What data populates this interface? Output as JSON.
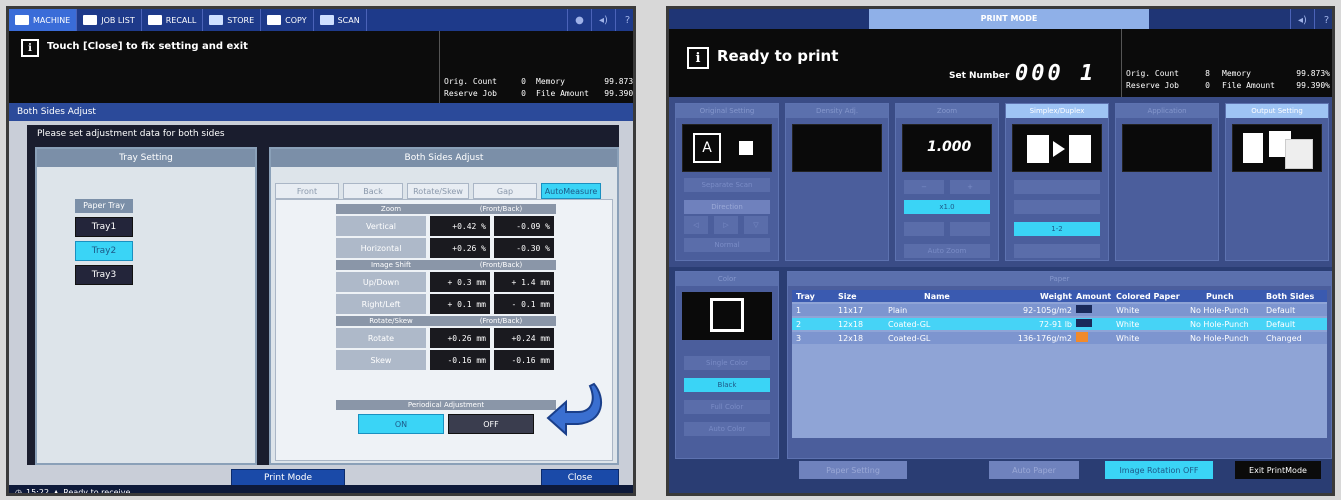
{
  "left": {
    "tabs": [
      "MACHINE",
      "JOB LIST",
      "RECALL",
      "STORE",
      "COPY",
      "SCAN"
    ],
    "message": "Touch [Close] to fix setting and exit",
    "info_icon": "i",
    "counter": {
      "orig_count_label": "Orig. Count",
      "orig_count_value": "0",
      "memory_label": "Memory",
      "memory_value": "99.873%",
      "reserve_job_label": "Reserve Job",
      "reserve_job_value": "0",
      "file_amount_label": "File Amount",
      "file_amount_value": "99.390%"
    },
    "window_title": "Both Sides Adjust",
    "instruction": "Please set adjustment data for both sides",
    "tray_setting": {
      "title": "Tray Setting",
      "paper_tray_label": "Paper Tray",
      "trays": [
        "Tray1",
        "Tray2",
        "Tray3"
      ],
      "selected_tray": "Tray2"
    },
    "both_sides": {
      "title": "Both Sides Adjust",
      "tabs": [
        "Front",
        "Back",
        "Rotate/Skew",
        "Gap",
        "AutoMeasure"
      ],
      "active_tab": "AutoMeasure",
      "groups": [
        {
          "label": "Zoom",
          "header_right": "(Front/Back)",
          "rows": [
            {
              "label": "Vertical",
              "front": "+0.42 %",
              "back": "-0.09 %"
            },
            {
              "label": "Horizontal",
              "front": "+0.26 %",
              "back": "-0.30 %"
            }
          ]
        },
        {
          "label": "Image Shift",
          "header_right": "(Front/Back)",
          "rows": [
            {
              "label": "Up/Down",
              "front": "+ 0.3 mm",
              "back": "+ 1.4 mm"
            },
            {
              "label": "Right/Left",
              "front": "+ 0.1 mm",
              "back": "- 0.1 mm"
            }
          ]
        },
        {
          "label": "Rotate/Skew",
          "header_right": "(Front/Back)",
          "rows": [
            {
              "label": "Rotate",
              "front": "+0.26 mm",
              "back": "+0.24 mm"
            },
            {
              "label": "Skew",
              "front": "-0.16 mm",
              "back": "-0.16 mm"
            }
          ]
        }
      ],
      "periodical_label": "Periodical Adjustment",
      "on_label": "ON",
      "off_label": "OFF"
    },
    "print_mode_button": "Print Mode",
    "close_button": "Close",
    "status_time": "15:22",
    "status_text": "Ready to receive"
  },
  "right": {
    "title": "PRINT MODE",
    "message": "Ready to print",
    "info_icon": "i",
    "set_number_label": "Set Number",
    "set_number_value": "000 1",
    "counter": {
      "orig_count_label": "Orig. Count",
      "orig_count_value": "8",
      "memory_label": "Memory",
      "memory_value": "99.873%",
      "reserve_job_label": "Reserve Job",
      "reserve_job_value": "0",
      "file_amount_label": "File Amount",
      "file_amount_value": "99.390%"
    },
    "func_cols": [
      {
        "label": "Original Setting"
      },
      {
        "label": "Density Adj."
      },
      {
        "label": "Zoom"
      },
      {
        "label": "Simplex/Duplex"
      },
      {
        "label": "Application"
      },
      {
        "label": "Output Setting"
      }
    ],
    "zoom_value": "1.000",
    "zoom_btn_1": "x1.0",
    "zoom_btn_2": "Auto Zoom",
    "duplex_btn": "1-2",
    "orig_sub": "Separate Scan",
    "direction_label": "Direction",
    "normal_label": "Normal",
    "color_title": "Color",
    "color_buttons": [
      "Single Color",
      "Black",
      "Full Color",
      "Auto Color"
    ],
    "color_selected": "Black",
    "paper_title": "Paper",
    "paper_headers": [
      "Tray",
      "Size",
      "Name",
      "Weight",
      "Amount",
      "Colored Paper",
      "Punch",
      "Both Sides"
    ],
    "paper_rows": [
      {
        "tray": "1",
        "size": "11x17",
        "name": "Plain",
        "weight": "92-105g/m2",
        "amount": "full",
        "color": "White",
        "punch": "No Hole-Punch",
        "both": "Default"
      },
      {
        "tray": "2",
        "size": "12x18",
        "name": "Coated-GL",
        "weight": "72-91 lb",
        "amount": "full",
        "color": "White",
        "punch": "No Hole-Punch",
        "both": "Default"
      },
      {
        "tray": "3",
        "size": "12x18",
        "name": "Coated-GL",
        "weight": "136-176g/m2",
        "amount": "low",
        "color": "White",
        "punch": "No Hole-Punch",
        "both": "Changed"
      }
    ],
    "selected_row": 1,
    "footer": {
      "paper_setting": "Paper Setting",
      "auto_paper": "Auto Paper",
      "image_rotation": "Image Rotation OFF",
      "exit": "Exit PrintMode"
    }
  },
  "colors": {
    "accent_cyan": "#3ad4f6",
    "header_blue": "#1e3a8a",
    "panel_bg": "#dde4ea"
  }
}
